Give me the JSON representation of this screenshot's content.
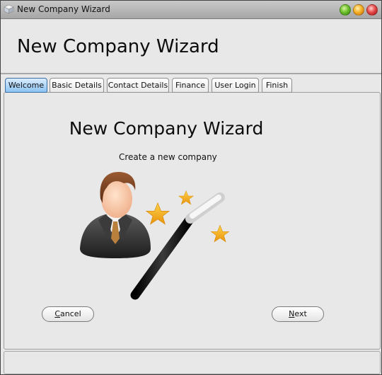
{
  "window": {
    "title": "New Company Wizard",
    "controls": [
      "minimize",
      "maximize",
      "close"
    ]
  },
  "header": {
    "title": "New Company Wizard"
  },
  "tabs": [
    {
      "label": "Welcome",
      "active": true
    },
    {
      "label": "Basic Details",
      "active": false
    },
    {
      "label": "Contact Details",
      "active": false
    },
    {
      "label": "Finance",
      "active": false
    },
    {
      "label": "User Login",
      "active": false
    },
    {
      "label": "Finish",
      "active": false
    }
  ],
  "welcome": {
    "title": "New Company Wizard",
    "subtitle": "Create a new company",
    "illustration": "businessman-with-magic-wand"
  },
  "buttons": {
    "cancel": {
      "mnemonic": "C",
      "rest": "ancel"
    },
    "next": {
      "mnemonic": "N",
      "rest": "ext"
    }
  },
  "icons": {
    "app": "app-cube-icon",
    "illustration": [
      "businessman-icon",
      "magic-wand-icon",
      "star-icon"
    ]
  }
}
